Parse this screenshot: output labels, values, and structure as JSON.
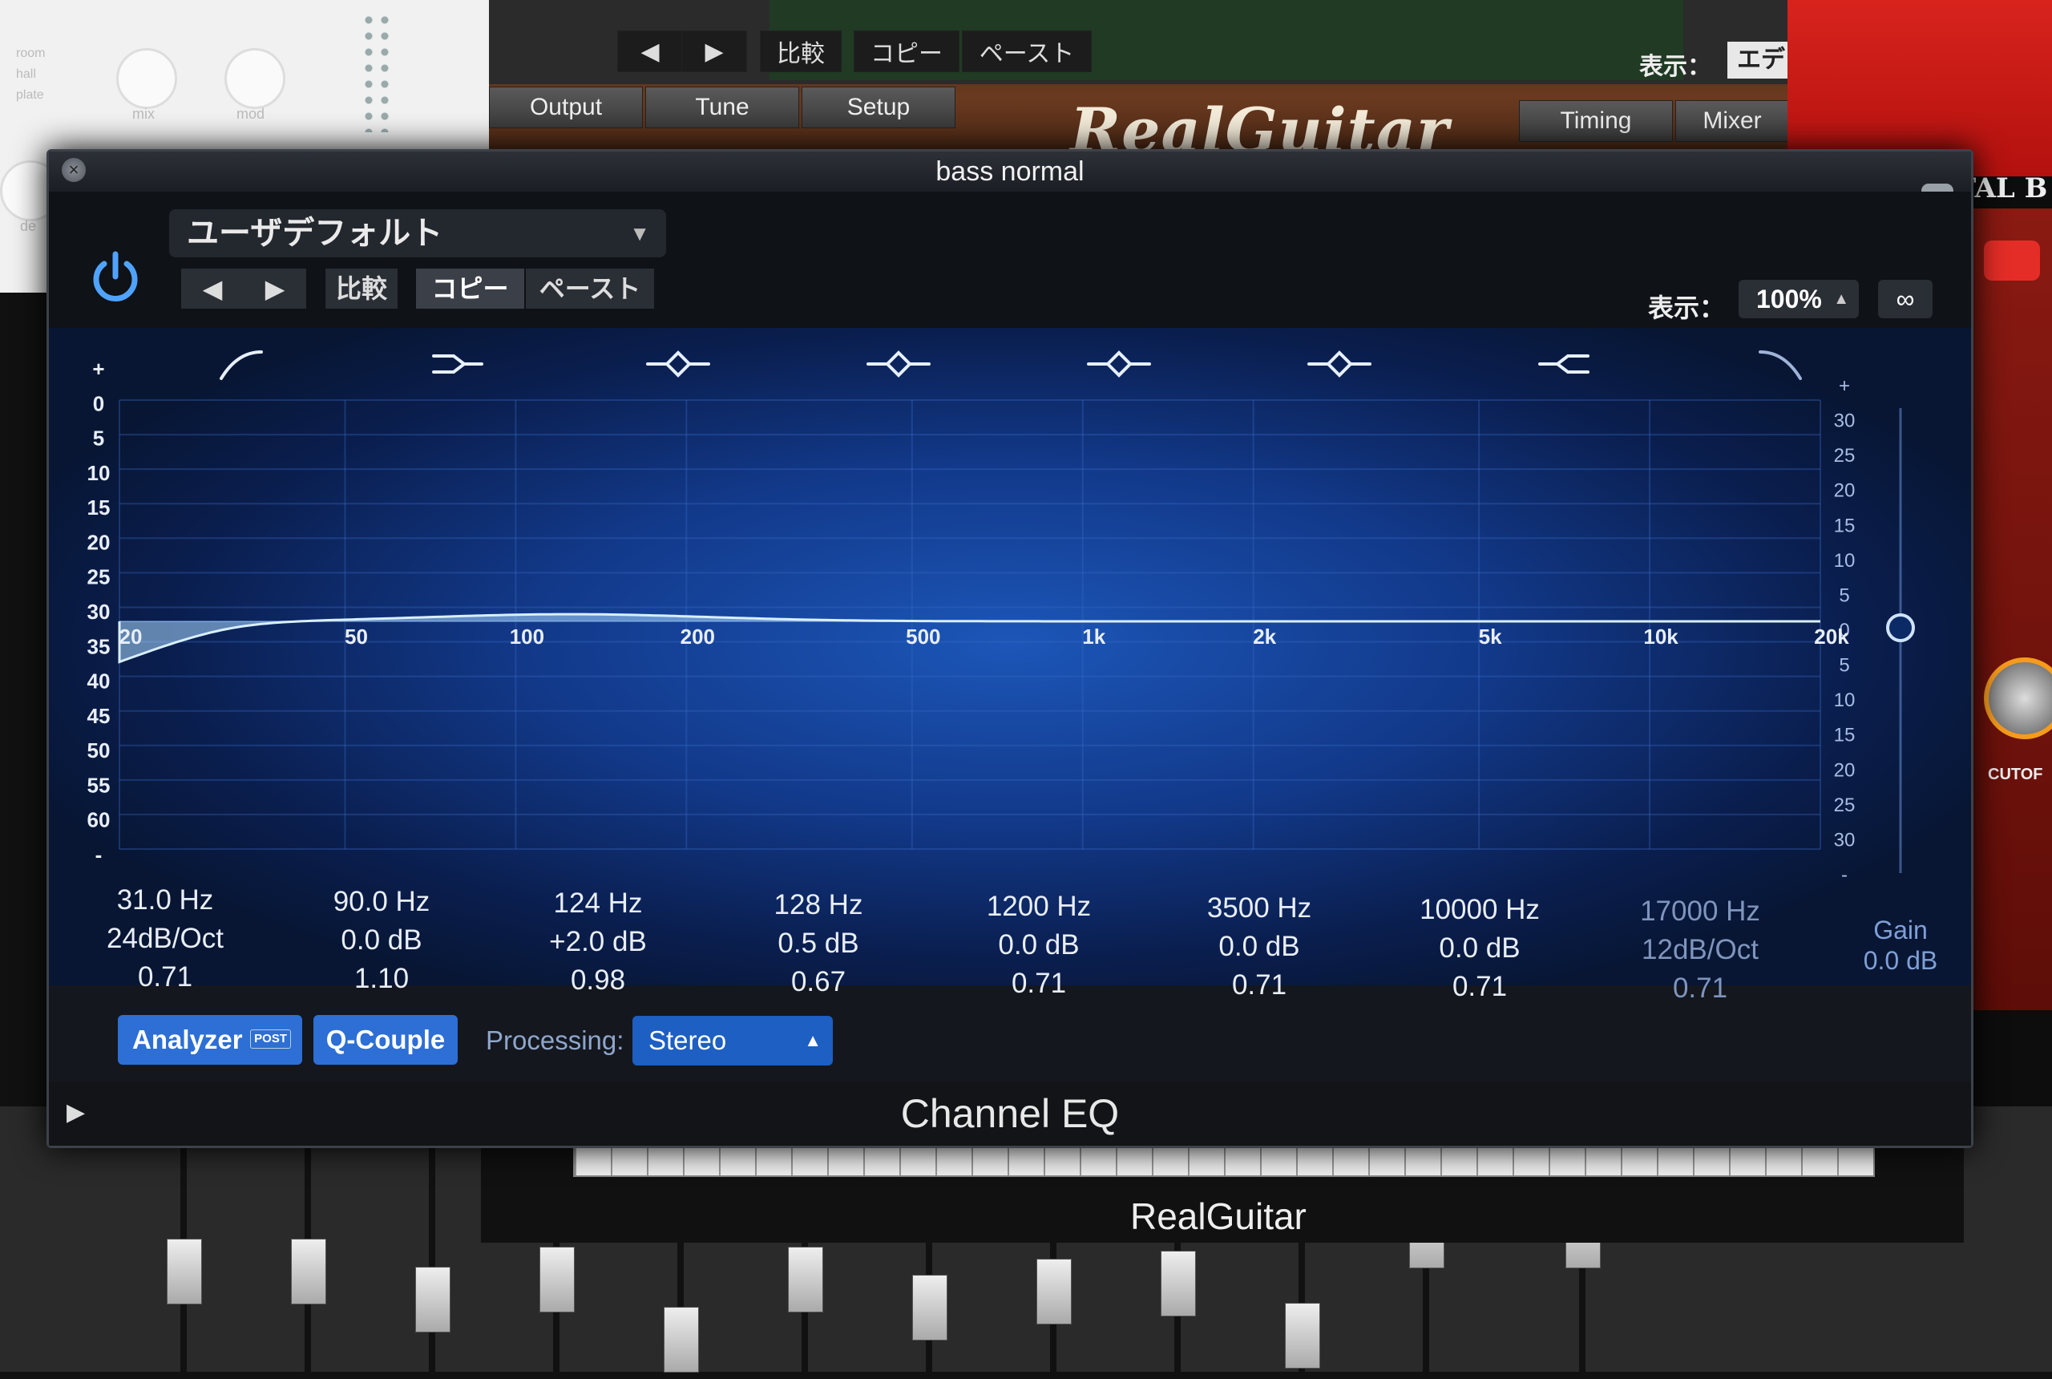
{
  "eq": {
    "window_title": "bass normal",
    "footer_title": "Channel EQ",
    "preset": "ユーザデフォルト",
    "buttons": {
      "compare": "比較",
      "copy": "コピー",
      "paste": "ペースト"
    },
    "display": {
      "label": "表示：",
      "value": "100%"
    },
    "left_scale": [
      "+",
      "0",
      "5",
      "10",
      "15",
      "20",
      "25",
      "30",
      "35",
      "40",
      "45",
      "50",
      "55",
      "60",
      "-"
    ],
    "right_scale": [
      "+",
      "30",
      "25",
      "20",
      "15",
      "10",
      "5",
      "0",
      "5",
      "10",
      "15",
      "20",
      "25",
      "30",
      "-"
    ],
    "freq_labels": [
      "20",
      "50",
      "100",
      "200",
      "500",
      "1k",
      "2k",
      "5k",
      "10k",
      "20k"
    ],
    "bands": [
      {
        "type": "highpass",
        "freq": "31.0 Hz",
        "gain": "24dB/Oct",
        "q": "0.71",
        "enabled": true
      },
      {
        "type": "lowshelf",
        "freq": "90.0 Hz",
        "gain": "0.0 dB",
        "q": "1.10",
        "enabled": true
      },
      {
        "type": "bell",
        "freq": "124 Hz",
        "gain": "+2.0 dB",
        "q": "0.98",
        "enabled": true
      },
      {
        "type": "bell",
        "freq": "128 Hz",
        "gain": "0.5 dB",
        "q": "0.67",
        "enabled": true
      },
      {
        "type": "bell",
        "freq": "1200 Hz",
        "gain": "0.0 dB",
        "q": "0.71",
        "enabled": true
      },
      {
        "type": "bell",
        "freq": "3500 Hz",
        "gain": "0.0 dB",
        "q": "0.71",
        "enabled": true
      },
      {
        "type": "highshelf",
        "freq": "10000 Hz",
        "gain": "0.0 dB",
        "q": "0.71",
        "enabled": true
      },
      {
        "type": "lowpass",
        "freq": "17000 Hz",
        "gain": "12dB/Oct",
        "q": "0.71",
        "enabled": false
      }
    ],
    "gain": {
      "label": "Gain",
      "value": "0.0 dB"
    },
    "analyzer": {
      "label": "Analyzer",
      "badge": "POST"
    },
    "q_couple": "Q-Couple",
    "processing": {
      "label": "Processing:",
      "value": "Stereo"
    },
    "colors": {
      "accent": "#2d6fd4",
      "curve_fill": "#a9d8ff",
      "graph_center": "#1c56b8",
      "graph_edge": "#081634"
    }
  },
  "background": {
    "realguitar": {
      "tabs_left": [
        "Output",
        "Tune",
        "Setup"
      ],
      "tabs_right": [
        "Timing",
        "Mixer"
      ],
      "logo": "RealGuitar",
      "toolbar": {
        "compare": "比較",
        "copy": "コピー",
        "paste": "ペースト"
      },
      "display_label": "表示：",
      "display_value": "エデ",
      "bottom_title": "RealGuitar"
    },
    "white_plugin": {
      "knob_labels": [
        "mix",
        "mod",
        "de"
      ],
      "legend": [
        "room",
        "hall",
        "plate"
      ]
    },
    "red_plugin": {
      "title": "TAL B",
      "knob_label": "CUTOF"
    }
  }
}
